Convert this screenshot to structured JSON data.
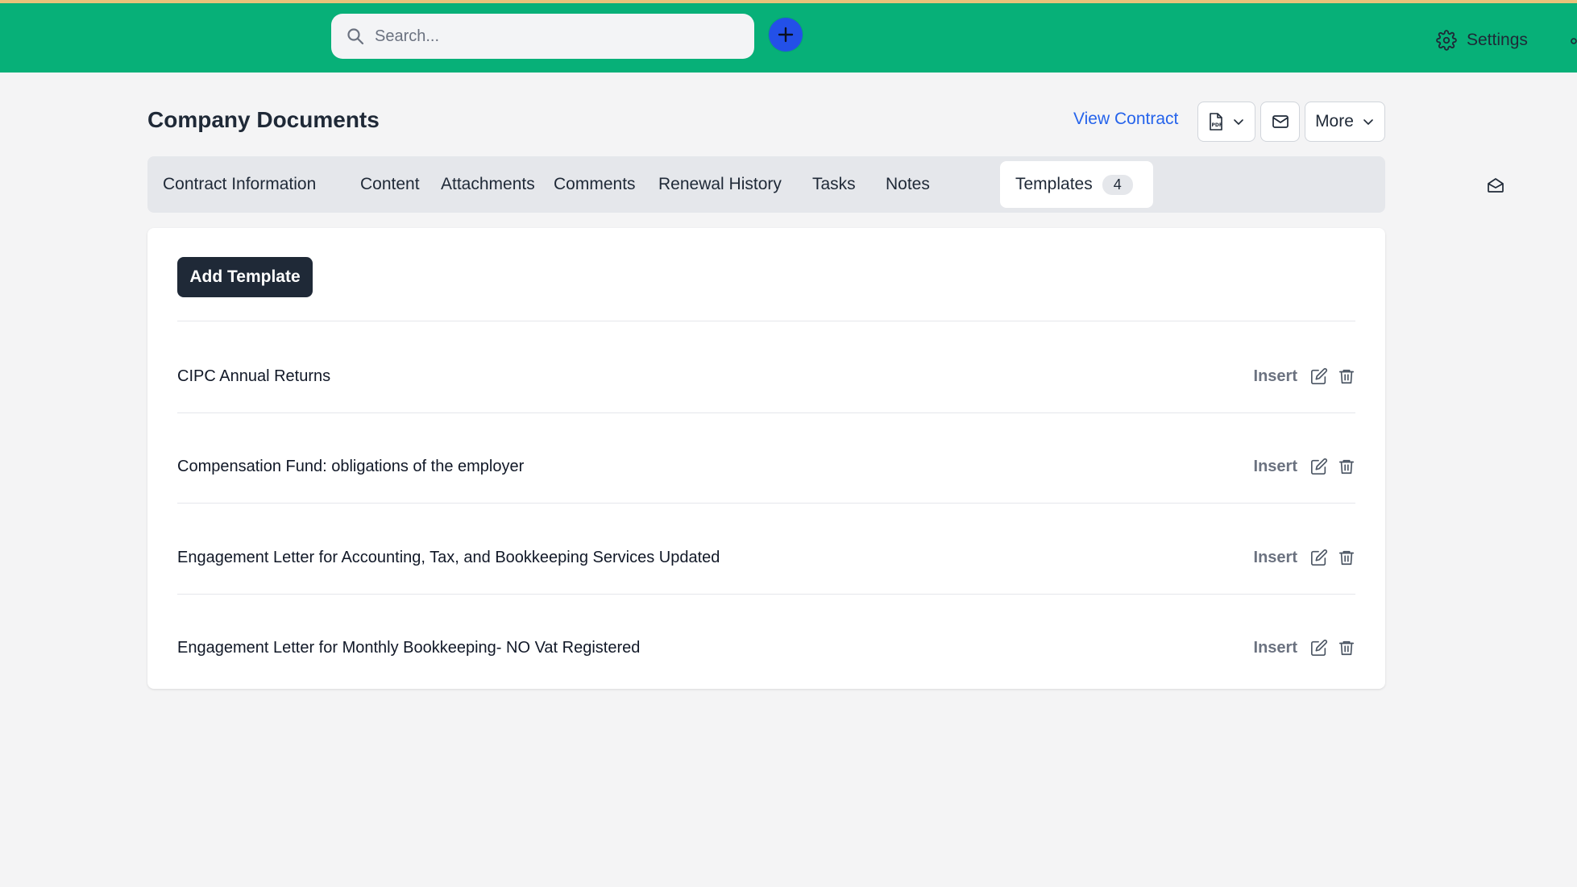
{
  "topbar": {
    "search_placeholder": "Search...",
    "settings_label": "Settings",
    "accent_color": "#07b078",
    "plus_color": "#2350e8"
  },
  "header": {
    "title": "Company Documents",
    "view_contract": "View Contract",
    "more_label": "More"
  },
  "tabs": [
    {
      "label": "Contract Information"
    },
    {
      "label": "Content"
    },
    {
      "label": "Attachments"
    },
    {
      "label": "Comments"
    },
    {
      "label": "Renewal History"
    },
    {
      "label": "Tasks"
    },
    {
      "label": "Notes"
    },
    {
      "label": "Templates",
      "count": "4",
      "active": true
    }
  ],
  "templates": {
    "add_label": "Add Template",
    "insert_label": "Insert",
    "items": [
      {
        "title": "CIPC Annual Returns"
      },
      {
        "title": "Compensation Fund: obligations of the employer"
      },
      {
        "title": "Engagement Letter for Accounting, Tax, and Bookkeeping Services Updated"
      },
      {
        "title": "Engagement Letter for Monthly Bookkeeping- NO Vat Registered"
      }
    ]
  },
  "icons": {
    "search": "search-icon",
    "plus": "plus-icon",
    "settings": "gear-icon",
    "pdf": "pdf-file-icon",
    "mail": "mail-icon",
    "edit": "edit-icon",
    "delete": "trash-icon",
    "envelope_open": "envelope-open-icon"
  }
}
